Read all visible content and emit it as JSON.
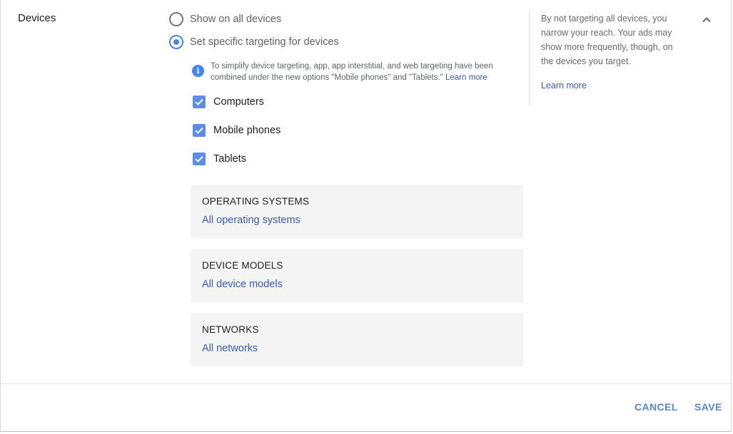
{
  "section": {
    "title": "Devices"
  },
  "targeting": {
    "options": [
      {
        "label": "Show on all devices",
        "selected": false
      },
      {
        "label": "Set specific targeting for devices",
        "selected": true
      }
    ],
    "info": {
      "text": "To simplify device targeting, app, app interstitial, and web targeting have been combined under the new options \"Mobile phones\" and \"Tablets.\"",
      "link": "Learn more"
    },
    "devices": [
      {
        "label": "Computers",
        "checked": true
      },
      {
        "label": "Mobile phones",
        "checked": true
      },
      {
        "label": "Tablets",
        "checked": true
      }
    ]
  },
  "cards": [
    {
      "title": "OPERATING SYSTEMS",
      "value": "All operating systems"
    },
    {
      "title": "DEVICE MODELS",
      "value": "All device models"
    },
    {
      "title": "NETWORKS",
      "value": "All networks"
    }
  ],
  "help": {
    "text": "By not targeting all devices, you narrow your reach. Your ads may show more frequently, though, on the devices you target.",
    "link": "Learn more"
  },
  "icons": {
    "info": "info-icon",
    "collapse": "chevron-up-icon",
    "check": "check-icon"
  },
  "colors": {
    "accent": "#4285f4",
    "link": "#3b5bbf",
    "checkbox": "#5b8ee6",
    "button": "#5b84d4"
  },
  "actions": {
    "cancel": "CANCEL",
    "save": "SAVE"
  }
}
